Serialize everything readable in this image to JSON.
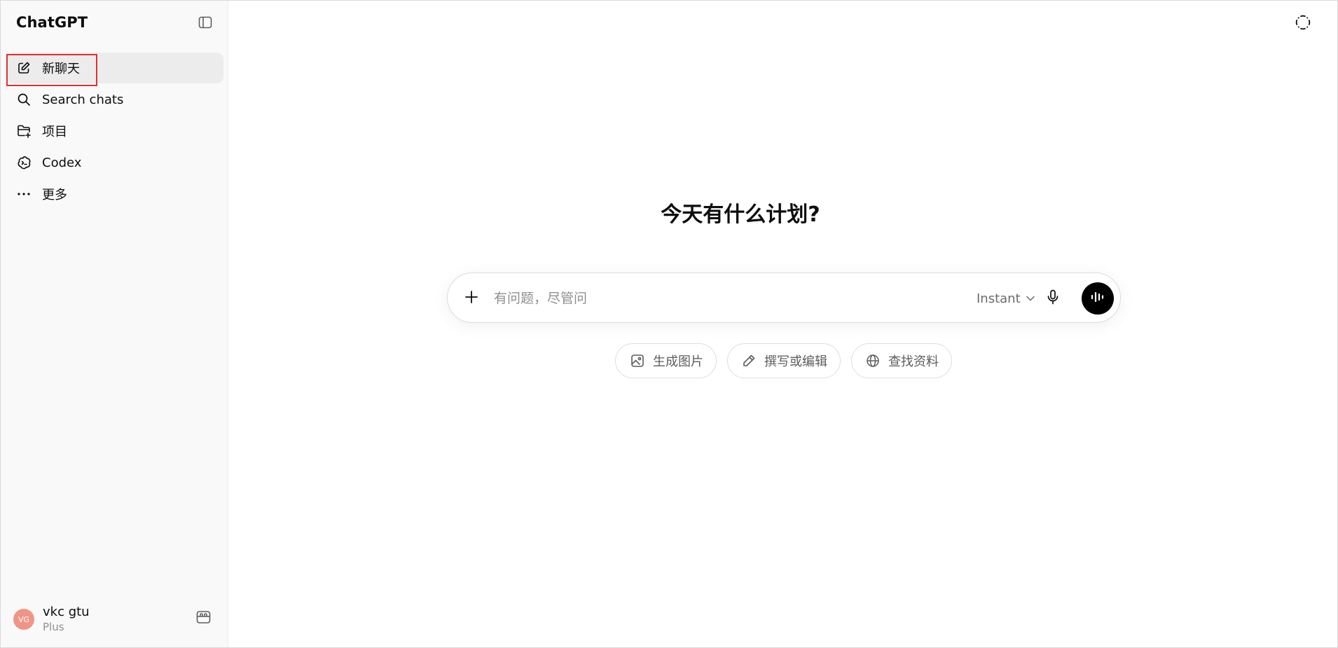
{
  "sidebar": {
    "brand": "ChatGPT",
    "items": [
      {
        "label": "新聊天",
        "icon": "edit-icon"
      },
      {
        "label": "Search chats",
        "icon": "search-icon"
      },
      {
        "label": "项目",
        "icon": "folder-plus-icon"
      },
      {
        "label": "Codex",
        "icon": "codex-icon"
      },
      {
        "label": "更多",
        "icon": "more-icon"
      }
    ],
    "user": {
      "initials": "VG",
      "name": "vkc gtu",
      "plan": "Plus",
      "avatar_color": "#f09585"
    }
  },
  "main": {
    "headline": "今天有什么计划?",
    "composer": {
      "placeholder": "有问题，尽管问",
      "model": "Instant"
    },
    "suggestions": [
      {
        "label": "生成图片",
        "icon": "image-icon"
      },
      {
        "label": "撰写或编辑",
        "icon": "pencil-icon"
      },
      {
        "label": "查找资料",
        "icon": "globe-icon"
      }
    ]
  },
  "colors": {
    "accent": "#000000",
    "highlight_border": "#e0312e",
    "sidebar_bg": "#f9f9f9"
  }
}
